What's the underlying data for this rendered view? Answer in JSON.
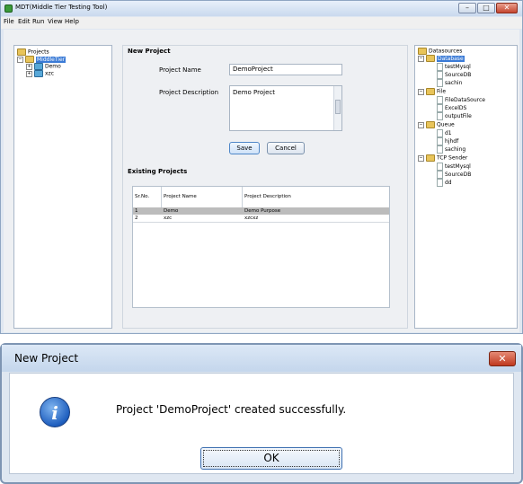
{
  "window": {
    "title": "MDT(Middle Tier Testing Tool)",
    "menu": [
      "File",
      "Edit",
      "Run",
      "View",
      "Help"
    ],
    "controls": {
      "minimize": "–",
      "maximize": "□",
      "close": "✕"
    }
  },
  "projects_tree": {
    "root": "Projects",
    "selected": "MiddleTier",
    "children": [
      "Demo",
      "xzc"
    ]
  },
  "new_project": {
    "section_title": "New Project",
    "name_label": "Project Name",
    "name_value": "DemoProject",
    "desc_label": "Project Description",
    "desc_value": "Demo Project",
    "save_label": "Save",
    "cancel_label": "Cancel"
  },
  "existing_projects": {
    "section_title": "Existing Projects",
    "columns": [
      "Sr.No.",
      "Project Name",
      "Project Description"
    ],
    "rows": [
      [
        "1",
        "Demo",
        "Demo Purpose"
      ],
      [
        "2",
        "xzc",
        "xzcxz"
      ]
    ]
  },
  "datasources_tree": {
    "root": "Datasources",
    "groups": [
      {
        "name": "Database",
        "items": [
          "testMysql",
          "SourceDB",
          "sachin"
        ]
      },
      {
        "name": "File",
        "items": [
          "FileDataSource",
          "ExcelDS",
          "outputFile"
        ]
      },
      {
        "name": "Queue",
        "items": [
          "d1",
          "hjhdf",
          "saching"
        ]
      },
      {
        "name": "TCP Sender",
        "items": [
          "testMysql",
          "SourceDB",
          "dd"
        ]
      }
    ]
  },
  "dialog": {
    "title": "New Project",
    "message": "Project 'DemoProject' created successfully.",
    "ok_label": "OK",
    "icon": "i",
    "close_label": "✕"
  },
  "colors": {
    "selection": "#3b7bd6",
    "row_selected": "#bcbcbc"
  }
}
